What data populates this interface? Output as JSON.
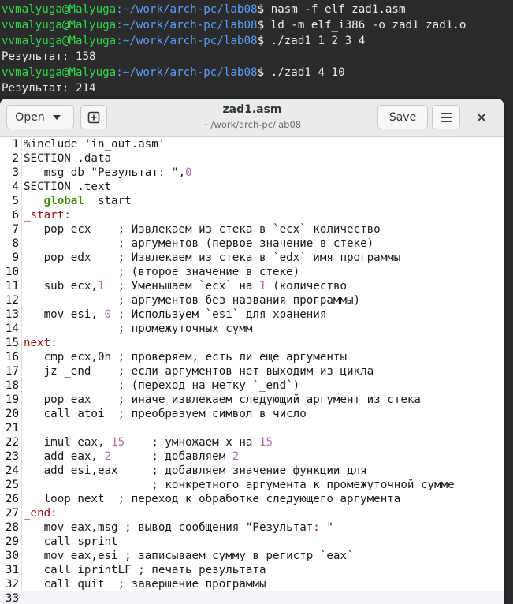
{
  "terminal": {
    "lines": [
      {
        "user": "vvmalyuga@Malyuga",
        "path": ":~/work/arch-pc/lab08",
        "cmd": "$ nasm -f elf zad1.asm"
      },
      {
        "user": "vvmalyuga@Malyuga",
        "path": ":~/work/arch-pc/lab08",
        "cmd": "$ ld -m elf_i386 -o zad1 zad1.o"
      },
      {
        "user": "vvmalyuga@Malyuga",
        "path": ":~/work/arch-pc/lab08",
        "cmd": "$ ./zad1 1 2 3 4"
      },
      {
        "output": "Результат: 158"
      },
      {
        "user": "vvmalyuga@Malyuga",
        "path": ":~/work/arch-pc/lab08",
        "cmd": "$ ./zad1 4 10"
      },
      {
        "output": "Результат: 214"
      }
    ]
  },
  "editor": {
    "open_label": "Open",
    "save_label": "Save",
    "title": "zad1.asm",
    "subtitle": "~/work/arch-pc/lab08",
    "icons": {
      "open_caret": "chevron-down-icon",
      "new_tab": "new-tab-icon",
      "menu": "hamburger-menu-icon",
      "close": "close-icon"
    },
    "colors": {
      "keyword": "#3a8a00",
      "number": "#b36bae",
      "label": "#a31515"
    },
    "lines": [
      "%include 'in_out.asm'",
      "SECTION .data",
      "   msg db \"Результат: \",0",
      "SECTION .text",
      "   global _start",
      "_start:",
      "   pop ecx    ; Извлекаем из стека в `ecx` количество",
      "              ; аргументов (первое значение в стеке)",
      "   pop edx    ; Извлекаем из стека в `edx` имя программы",
      "              ; (второе значение в стеке)",
      "   sub ecx,1  ; Уменьшаем `ecx` на 1 (количество",
      "              ; аргументов без названия программы)",
      "   mov esi, 0 ; Используем `esi` для хранения",
      "              ; промежуточных сумм",
      "next:",
      "   cmp ecx,0h ; проверяем, есть ли еще аргументы",
      "   jz _end    ; если аргументов нет выходим из цикла",
      "              ; (переход на метку `_end`)",
      "   pop eax    ; иначе извлекаем следующий аргумент из стека",
      "   call atoi  ; преобразуем символ в число",
      "",
      "   imul eax, 15    ; умножаем x на 15",
      "   add eax, 2      ; добавляем 2",
      "   add esi,eax     ; добавляем значение функции для",
      "                   ; конкретного аргумента к промежуточной сумме",
      "   loop next  ; переход к обработке следующего аргумента",
      "_end:",
      "   mov eax,msg ; вывод сообщения \"Результат: \"",
      "   call sprint",
      "   mov eax,esi ; записываем сумму в регистр `eax`",
      "   call iprintLF ; печать результата",
      "   call quit  ; завершение программы",
      ""
    ]
  }
}
